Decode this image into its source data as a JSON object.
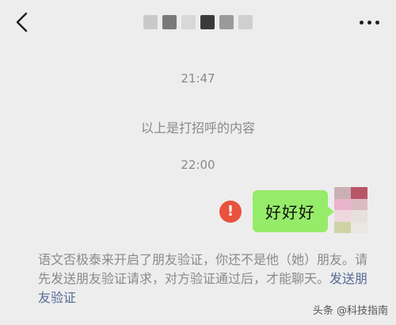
{
  "header": {
    "back_icon": "chevron-left-icon",
    "more_icon": "more-dots-icon",
    "title_blur_colors": [
      "#c9c9c9",
      "#7a7a7a",
      "#d8d8d8",
      "#3a3a3a",
      "#9a9a9a",
      "#cfcfcf"
    ]
  },
  "chat": {
    "timestamp_1": "21:47",
    "system_message": "以上是打招呼的内容",
    "timestamp_2": "22:00",
    "message_text": "好好好",
    "bubble_color": "#95ec69",
    "fail_icon_text": "!",
    "fail_color": "#e8523f"
  },
  "avatar": {
    "mosaic_colors": [
      "#c4a6ad",
      "#b03b53",
      "#eaa9c6",
      "#d9b3bb",
      "#f0d4dc",
      "#e6e0d8",
      "#c9cf9a",
      "#e9e6e0"
    ]
  },
  "notice": {
    "text": "语文否极泰来开启了朋友验证，你还不是他（她）朋友。请先发送朋友验证请求，对方验证通过后，才能聊天。",
    "link": "发送朋友验证",
    "link_color": "#576b95"
  },
  "watermark": "头条 @科技指南"
}
